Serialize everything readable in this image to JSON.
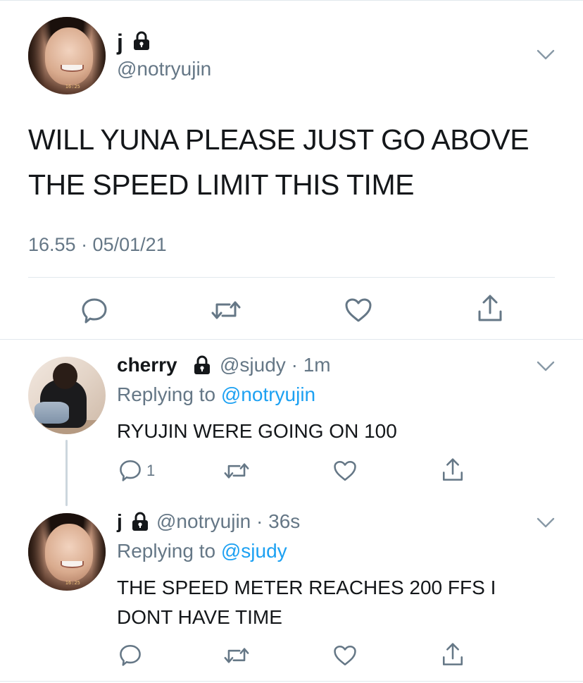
{
  "main_tweet": {
    "display_name": "j",
    "handle": "@notryujin",
    "text": "WILL YUNA PLEASE JUST GO ABOVE THE SPEED LIMIT THIS TIME",
    "timestamp": "16.55 · 05/01/21",
    "avatar_stamp": "16:25",
    "icons": [
      "lock-icon",
      "chevron-down-icon",
      "reply-icon",
      "retweet-icon",
      "like-icon",
      "share-icon"
    ]
  },
  "replies": [
    {
      "display_name": "cherry",
      "handle": "@sjudy",
      "time": "1m",
      "replying_prefix": "Replying to ",
      "replying_to": "@notryujin",
      "text": "RYUJIN WERE GOING ON 100",
      "reply_count": "1"
    },
    {
      "display_name": "j",
      "handle": "@notryujin",
      "time": "36s",
      "replying_prefix": "Replying to ",
      "replying_to": "@sjudy",
      "text": "THE SPEED METER REACHES 200 FFS I DONT HAVE TIME",
      "avatar_stamp": "16:25"
    }
  ],
  "colors": {
    "text": "#14171a",
    "secondary": "#657786",
    "link": "#1da1f2",
    "divider": "#e1e8ed",
    "thread_line": "#ccd6dd"
  }
}
